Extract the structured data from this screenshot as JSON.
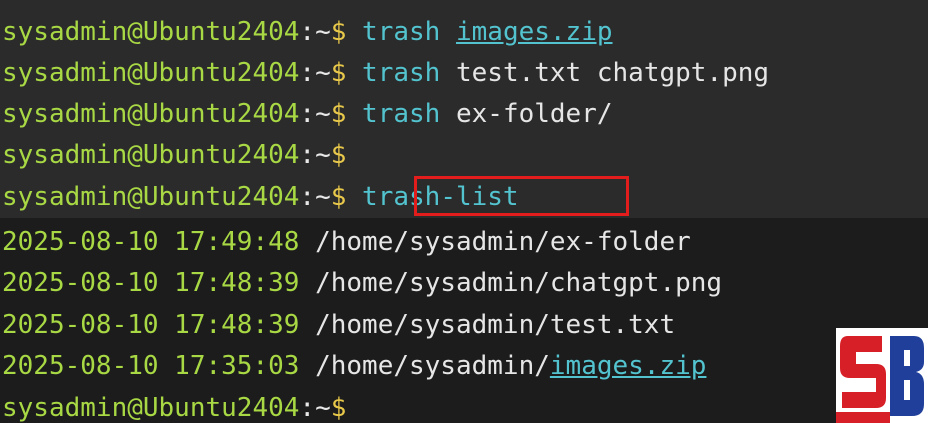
{
  "terminal": {
    "prompt": {
      "user_host": "sysadmin@Ubuntu2404",
      "separator": ":",
      "cwd": "~",
      "symbol": "$"
    },
    "lines": [
      {
        "type": "prompt",
        "command": "trash",
        "args": [
          {
            "text": "images.zip",
            "underlined": true
          }
        ]
      },
      {
        "type": "prompt",
        "command": "trash",
        "args": [
          {
            "text": "test.txt chatgpt.png",
            "underlined": false
          }
        ]
      },
      {
        "type": "prompt",
        "command": "trash",
        "args": [
          {
            "text": "ex-folder/",
            "underlined": false
          }
        ]
      },
      {
        "type": "prompt",
        "command": "",
        "args": []
      },
      {
        "type": "prompt",
        "command": "trash-list",
        "args": [],
        "highlighted": true
      },
      {
        "type": "output",
        "timestamp": "2025-08-10 17:49:48",
        "path": "/home/sysadmin/ex-folder",
        "link": ""
      },
      {
        "type": "output",
        "timestamp": "2025-08-10 17:48:39",
        "path": "/home/sysadmin/chatgpt.png",
        "link": ""
      },
      {
        "type": "output",
        "timestamp": "2025-08-10 17:48:39",
        "path": "/home/sysadmin/test.txt",
        "link": ""
      },
      {
        "type": "output",
        "timestamp": "2025-08-10 17:35:03",
        "path": "/home/sysadmin/",
        "link": "images.zip"
      },
      {
        "type": "prompt",
        "command": "",
        "args": []
      }
    ]
  },
  "colors": {
    "background_top": "#2b2b2b",
    "background_bottom": "#1c1c1c",
    "user_host": "#a8d844",
    "command": "#53c4cf",
    "dollar": "#e8c84a",
    "highlight_box": "#e31c1c"
  },
  "watermark": {
    "icon": "sb-logo-icon"
  }
}
